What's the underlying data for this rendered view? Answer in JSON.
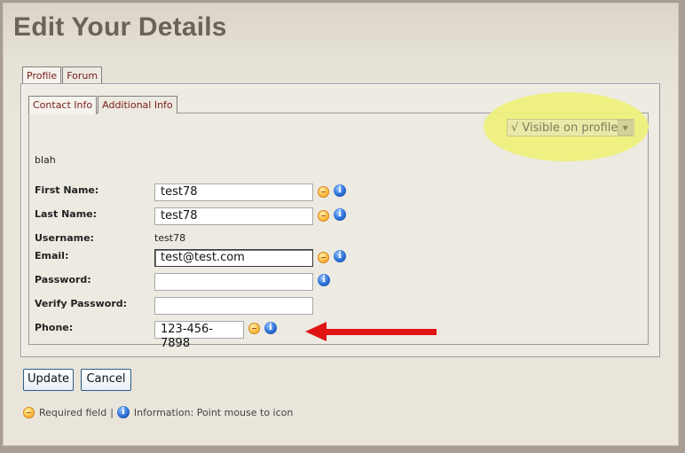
{
  "page": {
    "title": "Edit Your Details"
  },
  "outer_tabs": [
    {
      "label": "Profile",
      "active": true
    },
    {
      "label": "Forum",
      "active": false
    }
  ],
  "inner_tabs": [
    {
      "label": "Contact Info",
      "active": true
    },
    {
      "label": "Additional Info",
      "active": false
    }
  ],
  "visibility": {
    "value": "√ Visible on profile"
  },
  "intro_text": "blah",
  "form": {
    "first_name": {
      "label": "First Name:",
      "value": "test78",
      "required": true
    },
    "last_name": {
      "label": "Last Name:",
      "value": "test78",
      "required": true
    },
    "username": {
      "label": "Username:",
      "value": "test78"
    },
    "email": {
      "label": "Email:",
      "value": "test@test.com",
      "required": true
    },
    "password": {
      "label": "Password:",
      "value": ""
    },
    "verify_password": {
      "label": "Verify Password:",
      "value": ""
    },
    "phone": {
      "label": "Phone:",
      "value": "123-456-7898",
      "required": true
    }
  },
  "buttons": {
    "update": "Update",
    "cancel": "Cancel"
  },
  "legend": {
    "required": "Required field",
    "separator": "|",
    "info": "Information: Point mouse to icon"
  },
  "colors": {
    "annotation_arrow": "#e01414",
    "highlight": "#eef07a",
    "tab_text": "#7a1c1c"
  }
}
